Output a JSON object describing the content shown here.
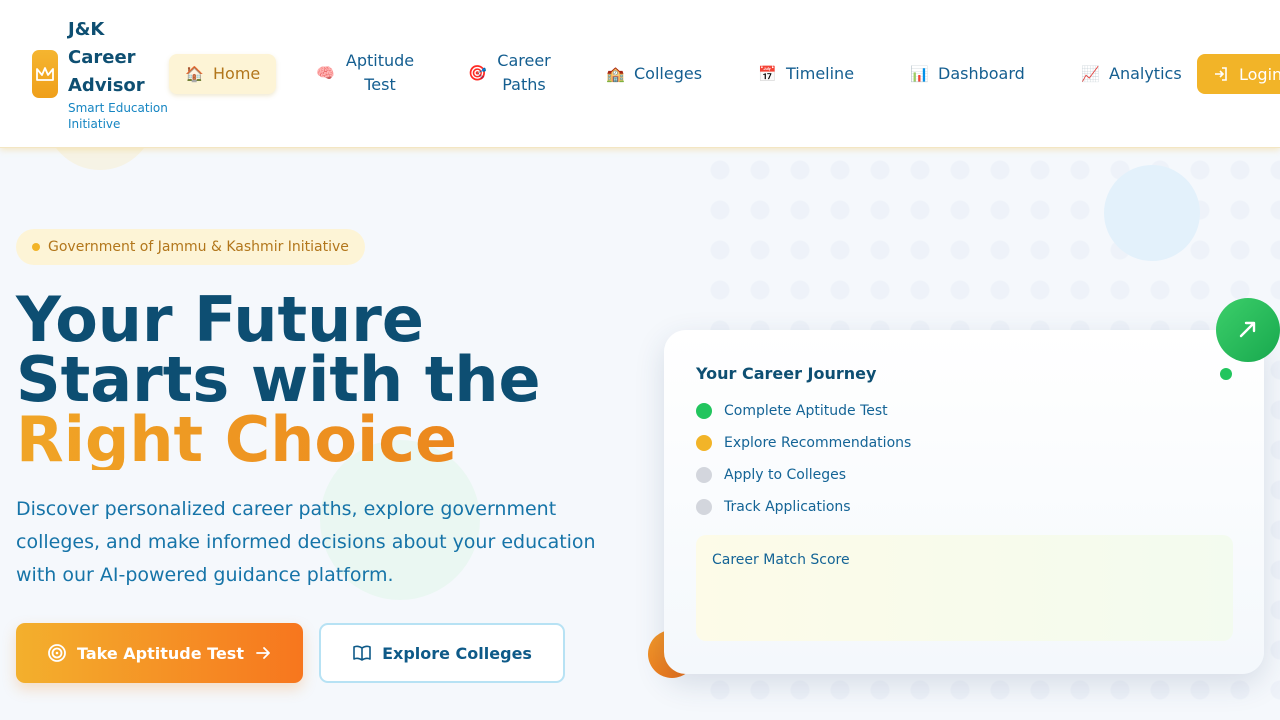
{
  "brand": {
    "title": "J&K Career Advisor",
    "subtitle": "Smart Education Initiative",
    "logo_icon": "crown-icon"
  },
  "nav": {
    "items": [
      {
        "label": "Home",
        "icon": "home-icon",
        "glyph": "🏠",
        "active": true
      },
      {
        "label": "Aptitude Test",
        "icon": "brain-icon",
        "glyph": "🧠"
      },
      {
        "label": "Career Paths",
        "icon": "target-icon",
        "glyph": "🎯"
      },
      {
        "label": "Colleges",
        "icon": "school-icon",
        "glyph": "🏫"
      },
      {
        "label": "Timeline",
        "icon": "calendar-icon",
        "glyph": "📅"
      },
      {
        "label": "Dashboard",
        "icon": "bar-chart-icon",
        "glyph": "📊"
      },
      {
        "label": "Analytics",
        "icon": "trend-chart-icon",
        "glyph": "📈"
      }
    ],
    "login_label": "Login"
  },
  "hero": {
    "badge": "Government of Jammu & Kashmir Initiative",
    "title_line1": "Your Future",
    "title_line2": "Starts with the",
    "title_accent": "Right Choice",
    "description": "Discover personalized career paths, explore government colleges, and make informed decisions about your education with our AI-powered guidance platform.",
    "primary_button": "Take Aptitude Test",
    "secondary_button": "Explore Colleges"
  },
  "journey_card": {
    "title": "Your Career Journey",
    "steps": [
      {
        "label": "Complete Aptitude Test",
        "color": "#22c55e"
      },
      {
        "label": "Explore Recommendations",
        "color": "#f2b428"
      },
      {
        "label": "Apply to Colleges",
        "color": "#d3d6dd"
      },
      {
        "label": "Track Applications",
        "color": "#d3d6dd"
      }
    ],
    "score_label": "Career Match Score"
  },
  "colors": {
    "brand_yellow": "#f2b428",
    "brand_orange": "#f7761e",
    "brand_navy": "#0d4e72",
    "success_green": "#22c55e"
  }
}
